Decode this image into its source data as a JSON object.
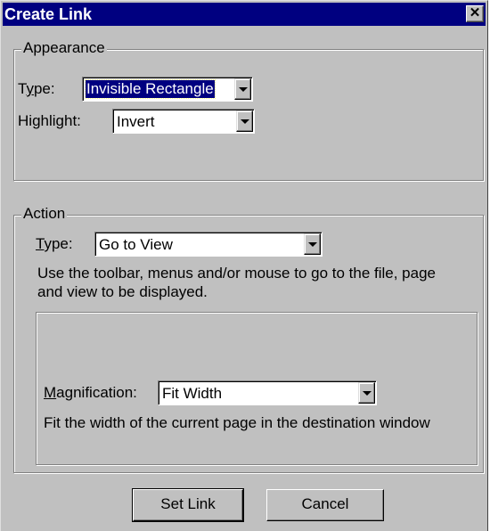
{
  "window": {
    "title": "Create Link",
    "close_glyph": "✕"
  },
  "appearance": {
    "legend": "Appearance",
    "type_label": "Type:",
    "type_value": "Invisible Rectangle",
    "highlight_label": "Highlight:",
    "highlight_value": "Invert"
  },
  "action": {
    "legend": "Action",
    "type_label": "Type:",
    "type_value": "Go to View",
    "description": "Use the toolbar, menus and/or mouse to go to the file, page and view to be displayed.",
    "magnification_label": "Magnification:",
    "magnification_value": "Fit Width",
    "magnification_description": "Fit the width of the current page in the destination window"
  },
  "buttons": {
    "set_link": "Set Link",
    "cancel": "Cancel"
  },
  "icons": {
    "close": "close-icon",
    "dropdown": "chevron-down-icon"
  },
  "colors": {
    "titlebar": "#000080",
    "face": "#c0c0c0",
    "selection": "#000080"
  }
}
